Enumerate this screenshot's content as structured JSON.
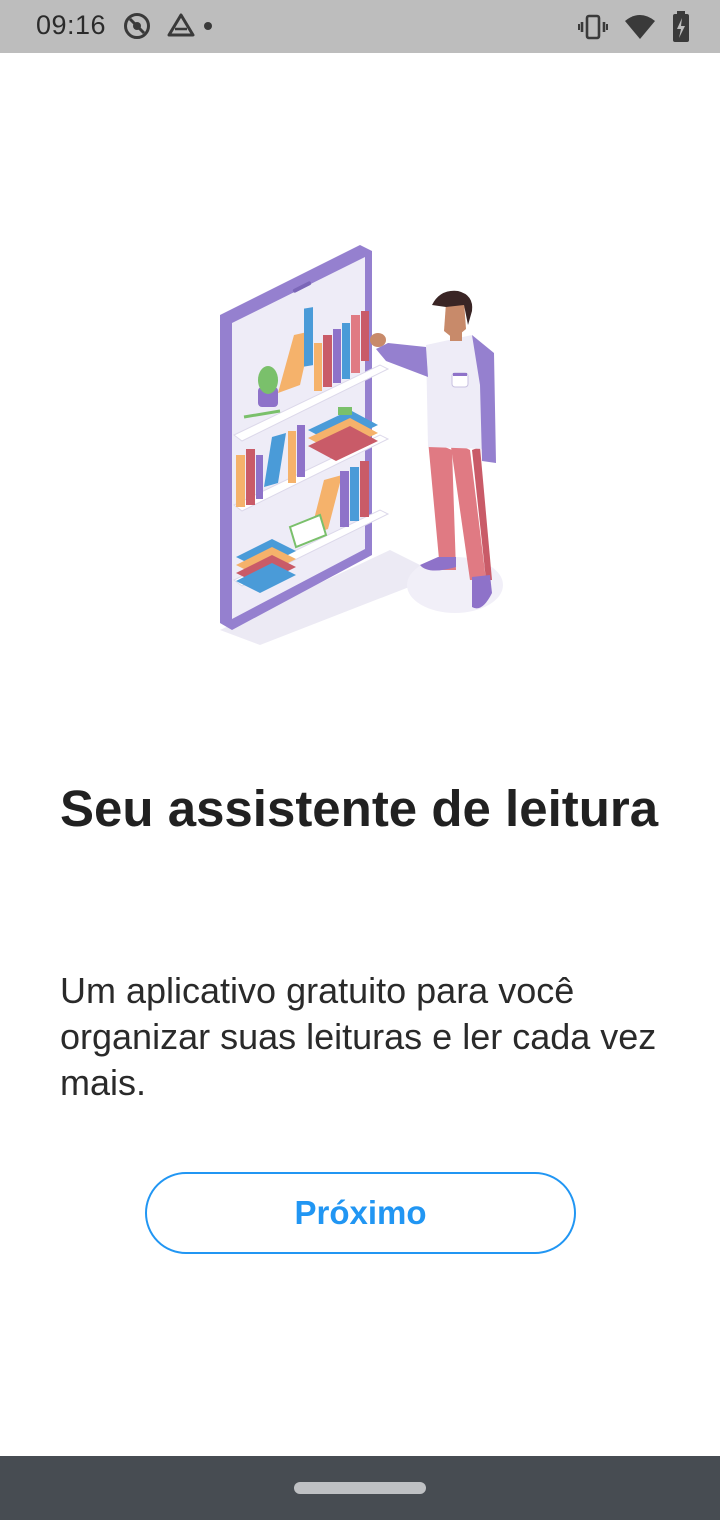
{
  "status_bar": {
    "time": "09:16",
    "left_icons": [
      "do-not-disturb-icon",
      "drive-icon",
      "notification-dot-icon"
    ],
    "right_icons": [
      "vibrate-icon",
      "wifi-icon",
      "battery-charging-icon"
    ],
    "background_color": "#bdbdbd"
  },
  "onboarding": {
    "illustration": "person-reading-bookshelf-phone-illustration",
    "title": "Seu assistente de leitura",
    "description": "Um aplicativo gratuito para você organizar suas leituras e ler cada vez mais.",
    "next_button_label": "Próximo",
    "accent_color": "#2196f3"
  },
  "navigation_bar": {
    "background_color": "#474c52",
    "home_handle": "gesture-home-handle"
  }
}
